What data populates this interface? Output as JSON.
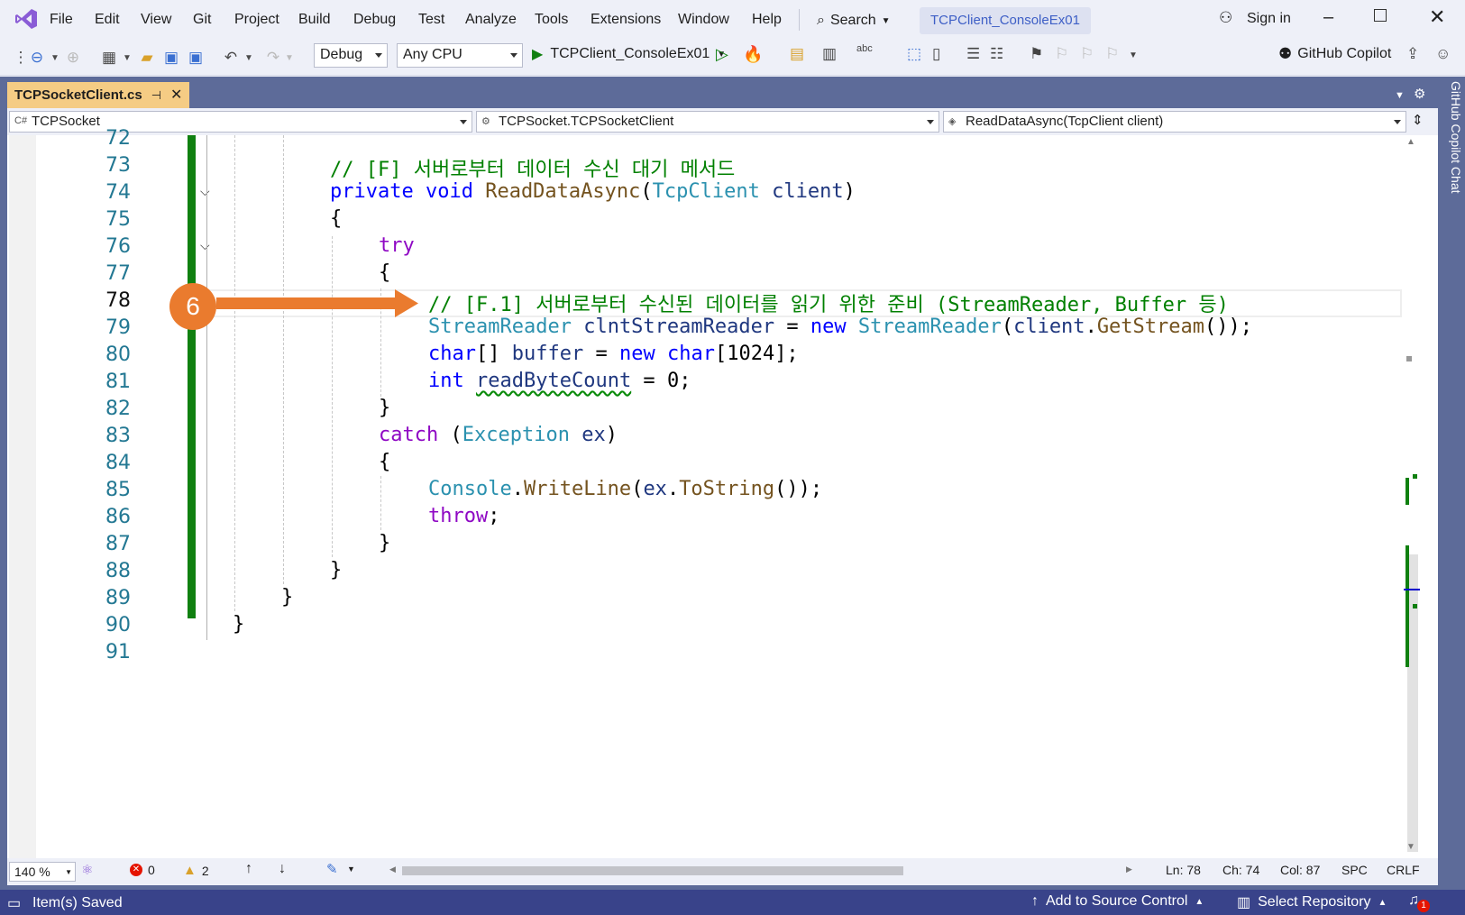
{
  "menu": [
    "File",
    "Edit",
    "View",
    "Git",
    "Project",
    "Build",
    "Debug",
    "Test",
    "Analyze",
    "Tools",
    "Extensions",
    "Window",
    "Help"
  ],
  "search_label": "Search",
  "window_title": "TCPClient_ConsoleEx01",
  "sign_in": "Sign in",
  "toolbar": {
    "config": "Debug",
    "platform": "Any CPU",
    "start_target": "TCPClient_ConsoleEx01",
    "copilot": "GitHub Copilot"
  },
  "tab": {
    "name": "TCPSocketClient.cs"
  },
  "nav": {
    "project": "TCPSocket",
    "type": "TCPSocket.TCPSocketClient",
    "member": "ReadDataAsync(TcpClient client)"
  },
  "code": {
    "lines": [
      "72",
      "73",
      "74",
      "75",
      "76",
      "77",
      "78",
      "79",
      "80",
      "81",
      "82",
      "83",
      "84",
      "85",
      "86",
      "87",
      "88",
      "89",
      "90",
      "91"
    ],
    "current_line": "78",
    "l73": "// [F] 서버로부터 데이터 수신 대기 메서드",
    "l74_kw1": "private",
    "l74_kw2": "void",
    "l74_method": "ReadDataAsync",
    "l74_type": "TcpClient",
    "l74_param": "client",
    "l76": "try",
    "l78": "// [F.1] 서버로부터 수신된 데이터를 읽기 위한 준비 (StreamReader, Buffer 등)",
    "l79_type1": "StreamReader",
    "l79_var": "clntStreamReader",
    "l79_new": "new",
    "l79_type2": "StreamReader",
    "l79_arg": "client",
    "l79_method": "GetStream",
    "l80_kw": "char",
    "l80_var": "buffer",
    "l80_new": "new",
    "l80_kw2": "char",
    "l80_num": "1024",
    "l81_kw": "int",
    "l81_var": "readByteCount",
    "l81_num": "0",
    "l83_kw": "catch",
    "l83_type": "Exception",
    "l83_var": "ex",
    "l85_type": "Console",
    "l85_method": "WriteLine",
    "l85_arg": "ex",
    "l85_method2": "ToString",
    "l86": "throw"
  },
  "annotation": {
    "step": "6",
    "color": "#ea7b2e"
  },
  "editor_status": {
    "zoom": "140 %",
    "errors": "0",
    "warnings": "2",
    "ln": "Ln: 78",
    "ch": "Ch: 74",
    "col": "Col: 87",
    "spc": "SPC",
    "crlf": "CRLF"
  },
  "statusbar": {
    "saved": "Item(s) Saved",
    "source_control": "Add to Source Control",
    "repository": "Select Repository",
    "notifications": "1"
  },
  "side_panel": "GitHub Copilot Chat",
  "colors": {
    "keyword": "#0000ff",
    "type": "#2b91af",
    "comment": "#008000",
    "change_bar": "#108010",
    "statusbar": "#39438a"
  }
}
